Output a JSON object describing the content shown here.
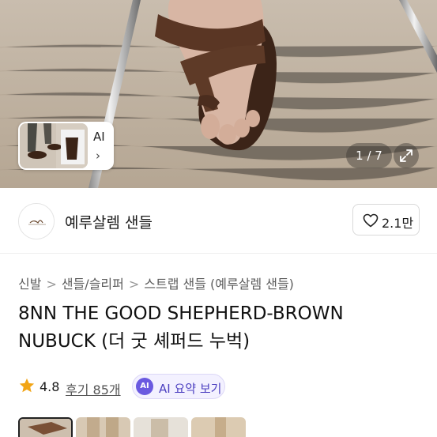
{
  "hero": {
    "counter": "1 / 7",
    "thumb_card": {
      "ai_label": "AI",
      "chevron": "›"
    },
    "expand_icon": "expand-icon"
  },
  "store": {
    "name": "예루살렘 샌들",
    "like_count": "2.1만",
    "heart_icon": "heart-outline-icon"
  },
  "breadcrumb": {
    "items": [
      "신발",
      "샌들/슬리퍼",
      "스트랩 샌들 (예루살렘 샌들)"
    ],
    "separator": ">"
  },
  "product": {
    "title": "8NN THE GOOD SHEPHERD-BROWN NUBUCK (더 굿 셰퍼드 누벅)"
  },
  "rating": {
    "value": "4.8",
    "reviews_label": "후기 85개",
    "star_color": "#f2a516"
  },
  "ai_summary": {
    "badge": "AI",
    "label": "AI 요약 보기"
  },
  "colors": {
    "accent": "#6a5ae0",
    "sandal_brown": "#5a3624"
  }
}
